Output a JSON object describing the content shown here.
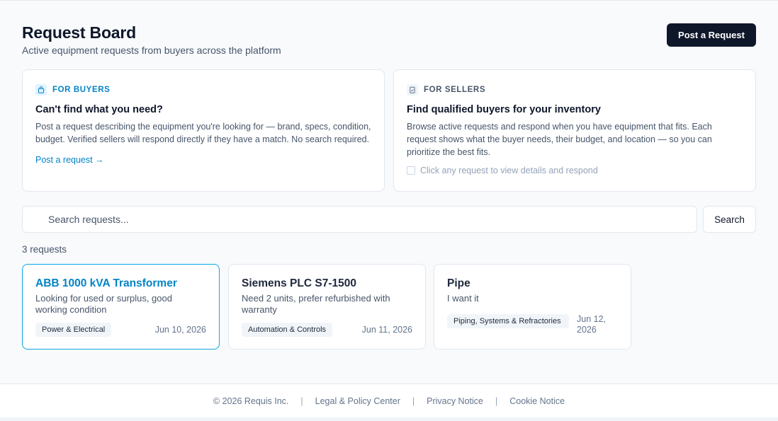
{
  "header": {
    "title": "Request Board",
    "subtitle": "Active equipment requests from buyers across the platform",
    "post_button": "Post a Request"
  },
  "buyers_card": {
    "eyebrow": "FOR BUYERS",
    "icon": "shopping-bag-icon",
    "heading": "Can't find what you need?",
    "body": "Post a request describing the equipment you're looking for — brand, specs, condition, budget. Verified sellers will respond directly if they have a match. No search required.",
    "link": "Post a request →"
  },
  "sellers_card": {
    "eyebrow": "FOR SELLERS",
    "icon": "clipboard-icon",
    "heading": "Find qualified buyers for your inventory",
    "body": "Browse active requests and respond when you have equipment that fits. Each request shows what the buyer needs, their budget, and location — so you can prioritize the best fits.",
    "hint": "Click any request to view details and respond"
  },
  "search": {
    "placeholder": "Search requests...",
    "button": "Search"
  },
  "results": {
    "count": "3 requests",
    "items": [
      {
        "title": "ABB 1000 kVA Transformer",
        "description": "Looking for used or surplus, good working condition",
        "tag": "Power & Electrical",
        "date": "Jun 10, 2026"
      },
      {
        "title": "Siemens PLC S7-1500",
        "description": "Need 2 units, prefer refurbished with warranty",
        "tag": "Automation & Controls",
        "date": "Jun 11, 2026"
      },
      {
        "title": "Pipe",
        "description": "I want it",
        "tag": "Piping, Systems & Refractories",
        "date": "Jun 12, 2026"
      }
    ]
  },
  "footer": {
    "copyright": "© 2026 Requis Inc.",
    "links": [
      "Legal & Policy Center",
      "Privacy Notice",
      "Cookie Notice"
    ],
    "separator": "|"
  },
  "colors": {
    "primary": "#0f172a",
    "accent": "#0284c7",
    "active_border": "#0ea5e9"
  }
}
